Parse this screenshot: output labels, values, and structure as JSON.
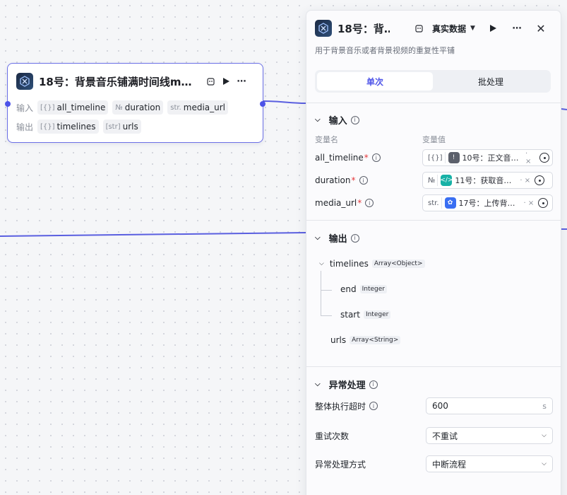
{
  "node": {
    "title": "18号：背景音乐铺满时间线m…",
    "input_label": "输入",
    "output_label": "输出",
    "inputs": [
      {
        "type": "[{}]",
        "name": "all_timeline"
      },
      {
        "type": "№",
        "name": "duration"
      },
      {
        "type": "str.",
        "name": "media_url"
      }
    ],
    "outputs": [
      {
        "type": "[{}]",
        "name": "timelines"
      },
      {
        "type": "[str]",
        "name": "urls"
      }
    ]
  },
  "panel": {
    "title": "18号：背…",
    "mode": "真实数据",
    "description": "用于背景音乐或者背景视频的重复性平铺",
    "tabs": [
      "单次",
      "批处理"
    ],
    "input_section": "输入",
    "col_name": "变量名",
    "col_value": "变量值",
    "variables": [
      {
        "name": "all_timeline",
        "type": "[{}]",
        "ref": "10号：正文音…",
        "icon_color": "#5c606b",
        "icon_glyph": "!"
      },
      {
        "name": "duration",
        "type": "№",
        "ref": "11号：获取音…",
        "icon_color": "#17b1a6",
        "icon_glyph": "</>"
      },
      {
        "name": "media_url",
        "type": "str.",
        "ref": "17号：上传背…",
        "icon_color": "#3a6ff2",
        "icon_glyph": "✿"
      }
    ],
    "output_section": "输出",
    "outputs": {
      "timelines": {
        "name": "timelines",
        "type": "Array<Object>"
      },
      "end": {
        "name": "end",
        "type": "Integer"
      },
      "start": {
        "name": "start",
        "type": "Integer"
      },
      "urls": {
        "name": "urls",
        "type": "Array<String>"
      }
    },
    "error_section": "异常处理",
    "timeout_label": "整体执行超时",
    "timeout_value": "600",
    "timeout_unit": "s",
    "retry_label": "重试次数",
    "retry_value": "不重试",
    "handling_label": "异常处理方式",
    "handling_value": "中断流程"
  },
  "colors": {
    "accent": "#4d53e8",
    "edge": "#5a5fe0",
    "required": "#e4373a"
  }
}
